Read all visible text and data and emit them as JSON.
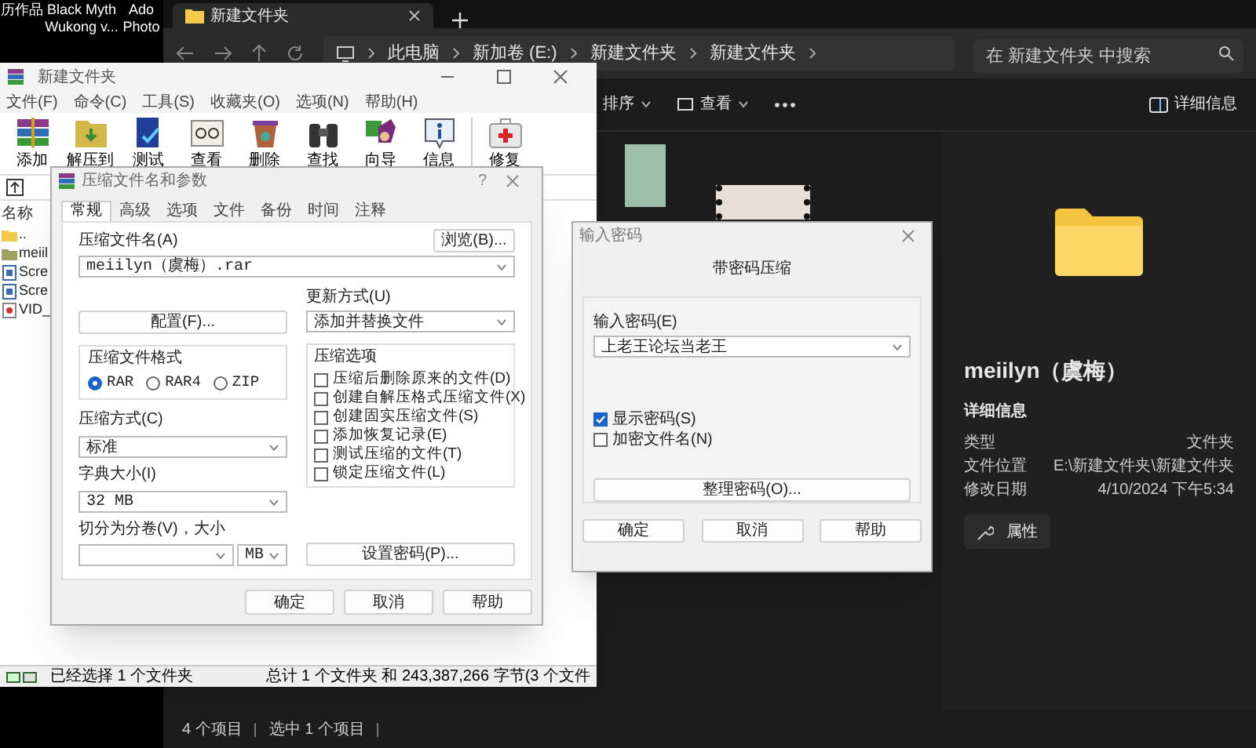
{
  "desktop_icons": [
    {
      "label": "历作品"
    },
    {
      "label": "Black Myth Wukong v..."
    },
    {
      "label": "Ado Photo"
    }
  ],
  "explorer": {
    "tab": {
      "title": "新建文件夹"
    },
    "breadcrumb": [
      "此电脑",
      "新加卷 (E:)",
      "新建文件夹",
      "新建文件夹"
    ],
    "search": {
      "placeholder": "在 新建文件夹 中搜索"
    },
    "toolbar": [
      "排序",
      "查看"
    ],
    "details_button": "详细信息",
    "details": {
      "name": "meiilyn（虞梅）",
      "heading": "详细信息",
      "rows": [
        {
          "label": "类型",
          "value": "文件夹"
        },
        {
          "label": "文件位置",
          "value": "E:\\新建文件夹\\新建文件夹"
        },
        {
          "label": "修改日期",
          "value": "4/10/2024 下午5:34"
        }
      ],
      "properties_button": "属性"
    },
    "status": [
      "4 个项目",
      "选中 1 个项目"
    ]
  },
  "winrar": {
    "title": "新建文件夹",
    "menu": [
      "文件(F)",
      "命令(C)",
      "工具(S)",
      "收藏夹(O)",
      "选项(N)",
      "帮助(H)"
    ],
    "tools": [
      "添加",
      "解压到",
      "测试",
      "查看",
      "删除",
      "查找",
      "向导",
      "信息",
      "修复"
    ],
    "list_header": "名称",
    "files": [
      {
        "name": "..",
        "kind": "up"
      },
      {
        "name": "meiil",
        "kind": "folder"
      },
      {
        "name": "Scre",
        "kind": "image"
      },
      {
        "name": "Scre",
        "kind": "image"
      },
      {
        "name": "VID_",
        "kind": "video"
      }
    ],
    "status_left": "已经选择 1 个文件夹",
    "status_right": "总计 1 个文件夹 和 243,387,266 字节(3 个文件"
  },
  "archive_dialog": {
    "title": "压缩文件名和参数",
    "help": "?",
    "tabs": [
      {
        "label": "常规",
        "selected": true
      },
      {
        "label": "高级",
        "selected": false
      },
      {
        "label": "选项",
        "selected": false
      },
      {
        "label": "文件",
        "selected": false
      },
      {
        "label": "备份",
        "selected": false
      },
      {
        "label": "时间",
        "selected": false
      },
      {
        "label": "注释",
        "selected": false
      }
    ],
    "archive_name_label": "压缩文件名(A)",
    "browse_button": "浏览(B)...",
    "archive_name": "meiilyn（虞梅）.rar",
    "profiles_button": "配置(F)...",
    "update_mode_label": "更新方式(U)",
    "update_mode": "添加并替换文件",
    "format_label": "压缩文件格式",
    "formats": [
      {
        "label": "RAR",
        "selected": true
      },
      {
        "label": "RAR4",
        "selected": false
      },
      {
        "label": "ZIP",
        "selected": false
      }
    ],
    "method_label": "压缩方式(C)",
    "method": "标准",
    "dict_label": "字典大小(I)",
    "dict": "32 MB",
    "split_label": "切分为分卷(V)，大小",
    "split_unit": "MB",
    "options_label": "压缩选项",
    "options": [
      {
        "label": "压缩后删除原来的文件(D)",
        "checked": false
      },
      {
        "label": "创建自解压格式压缩文件(X)",
        "checked": false
      },
      {
        "label": "创建固实压缩文件(S)",
        "checked": false
      },
      {
        "label": "添加恢复记录(E)",
        "checked": false
      },
      {
        "label": "测试压缩的文件(T)",
        "checked": false
      },
      {
        "label": "锁定压缩文件(L)",
        "checked": false
      }
    ],
    "password_button": "设置密码(P)...",
    "buttons": [
      "确定",
      "取消",
      "帮助"
    ]
  },
  "password_dialog": {
    "title": "输入密码",
    "heading": "带密码压缩",
    "password_label": "输入密码(E)",
    "password": "上老王论坛当老王",
    "checks": [
      {
        "label": "显示密码(S)",
        "checked": true
      },
      {
        "label": "加密文件名(N)",
        "checked": false
      }
    ],
    "organize_button": "整理密码(O)...",
    "buttons": [
      "确定",
      "取消",
      "帮助"
    ]
  }
}
